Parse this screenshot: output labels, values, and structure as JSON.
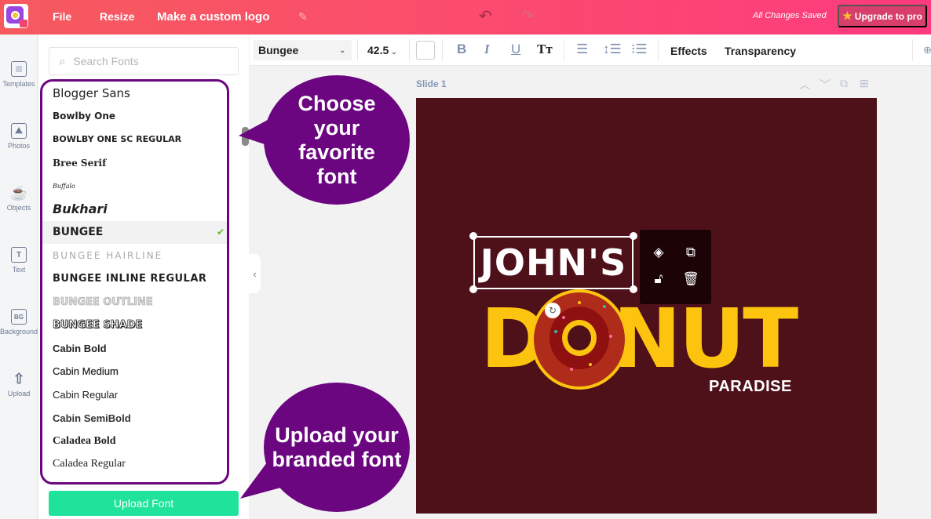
{
  "topbar": {
    "file": "File",
    "resize": "Resize",
    "title": "Make a custom logo",
    "status": "All Changes Saved",
    "upgrade": "Upgrade to pro",
    "icons": {
      "edit": "pencil-icon",
      "undo": "undo-icon",
      "redo": "redo-icon",
      "star": "star-icon"
    }
  },
  "rail": {
    "items": [
      {
        "label": "Templates",
        "icon": "templates-icon"
      },
      {
        "label": "Photos",
        "icon": "photos-icon"
      },
      {
        "label": "Objects",
        "icon": "objects-icon"
      },
      {
        "label": "Text",
        "icon": "text-icon",
        "glyph": "T"
      },
      {
        "label": "Background",
        "icon": "background-icon",
        "glyph": "BG"
      },
      {
        "label": "Upload",
        "icon": "upload-icon"
      }
    ]
  },
  "font_panel": {
    "search_placeholder": "Search Fonts",
    "fonts": [
      "Blogger Sans",
      "Bowlby One",
      "Bowlby One SC Regular",
      "Bree Serif",
      "Buffalo",
      "Bukhari",
      "BUNGEE",
      "BUNGEE HAIRLINE",
      "BUNGEE INLINE REGULAR",
      "BUNGEE OUTLINE",
      "BUNGEE SHADE",
      "Cabin Bold",
      "Cabin Medium",
      "Cabin Regular",
      "Cabin SemiBold",
      "Caladea Bold",
      "Caladea Regular"
    ],
    "selected_font": "BUNGEE",
    "upload_button": "Upload Font"
  },
  "toolbar": {
    "font_family": "Bungee",
    "font_size": "42.5",
    "text_color": "#ffffff",
    "bold": "B",
    "italic": "I",
    "underline": "U",
    "case": "Tт",
    "effects": "Effects",
    "transparency": "Transparency"
  },
  "canvas": {
    "slide_label": "Slide 1",
    "background_color": "#4f1119",
    "selected_text": "JOHN'S",
    "logo_text": "DONUT",
    "logo_subtext": "PARADISE",
    "logo_color": "#fdc40f"
  },
  "callouts": {
    "top": "Choose your favorite font",
    "bottom": "Upload your branded font",
    "color": "#6b0680"
  }
}
